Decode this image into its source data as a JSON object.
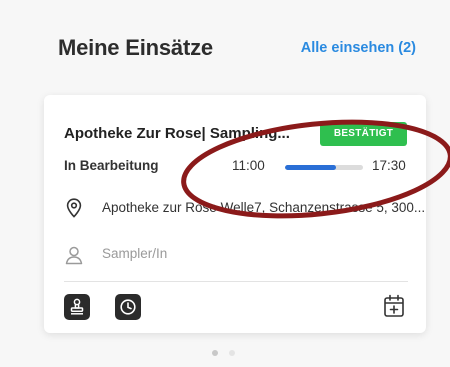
{
  "header": {
    "title": "Meine Einsätze",
    "see_all_label": "Alle einsehen (2)"
  },
  "card": {
    "title": "Apotheke Zur Rose| Sampling...",
    "badge": "BESTÄTIGT",
    "status": "In Bearbeitung",
    "time_start": "11:00",
    "time_end": "17:30",
    "progress_percent": 65,
    "address": "Apotheke zur Rose Welle7, Schanzenstrasse 5, 300...",
    "sampler_placeholder": "Sampler/In",
    "actions": [
      {
        "icon": "stamp-icon"
      },
      {
        "icon": "clock-icon"
      },
      {
        "icon": "calendar-add-icon"
      }
    ]
  },
  "pagination": {
    "total": 2,
    "active_index": 0
  },
  "colors": {
    "accent_blue": "#2a8ae0",
    "progress_blue": "#2a6fd6",
    "badge_green": "#2fbf4f",
    "annotation_red": "#8b1a1a"
  }
}
